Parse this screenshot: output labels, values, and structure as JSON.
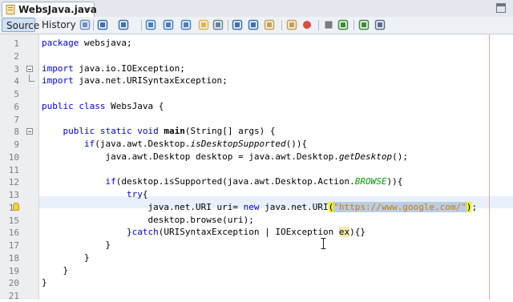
{
  "tab": {
    "filename": "WebsJava.java",
    "close_glyph": "×"
  },
  "toolbar": {
    "source_label": "Source",
    "history_label": "History",
    "icons": [
      "last-edit-icon",
      "back-icon",
      "forward-icon",
      "find-selection-icon",
      "find-previous-icon",
      "find-next-icon",
      "toggle-highlight-icon",
      "toggle-rectangular-icon",
      "shift-left-icon",
      "shift-right-icon",
      "comment-icon",
      "uncomment-icon",
      "start-macro-icon",
      "stop-macro-icon",
      "next-bookmark-icon",
      "previous-bookmark-icon",
      "toggle-bookmark-icon"
    ]
  },
  "editor": {
    "line_numbers": [
      "1",
      "2",
      "3",
      "4",
      "5",
      "6",
      "7",
      "8",
      "9",
      "10",
      "11",
      "12",
      "13",
      "14",
      "15",
      "16",
      "17",
      "18",
      "19",
      "20",
      "21"
    ],
    "lines": [
      {
        "segs": [
          {
            "t": "package",
            "c": "kw"
          },
          {
            "t": " websjava;"
          }
        ]
      },
      {
        "segs": []
      },
      {
        "segs": [
          {
            "t": "import",
            "c": "kw"
          },
          {
            "t": " java.io.IOException;"
          }
        ],
        "fold": "start"
      },
      {
        "segs": [
          {
            "t": "import",
            "c": "kw"
          },
          {
            "t": " java.net.URISyntaxException;"
          }
        ],
        "fold": "end"
      },
      {
        "segs": []
      },
      {
        "segs": [
          {
            "t": "public",
            "c": "kw"
          },
          {
            "t": " "
          },
          {
            "t": "class",
            "c": "kw"
          },
          {
            "t": " WebsJava {"
          }
        ]
      },
      {
        "segs": []
      },
      {
        "segs": [
          {
            "t": "    "
          },
          {
            "t": "public",
            "c": "kw"
          },
          {
            "t": " "
          },
          {
            "t": "static",
            "c": "kw"
          },
          {
            "t": " "
          },
          {
            "t": "void",
            "c": "kw"
          },
          {
            "t": " "
          },
          {
            "t": "main",
            "c": "bold"
          },
          {
            "t": "(String[] args) {"
          }
        ],
        "fold": "start"
      },
      {
        "segs": [
          {
            "t": "        "
          },
          {
            "t": "if",
            "c": "kw"
          },
          {
            "t": "(java.awt.Desktop."
          },
          {
            "t": "isDesktopSupported",
            "c": "mth"
          },
          {
            "t": "()){"
          }
        ]
      },
      {
        "segs": [
          {
            "t": "            java.awt.Desktop desktop = java.awt.Desktop."
          },
          {
            "t": "getDesktop",
            "c": "mth"
          },
          {
            "t": "();"
          }
        ]
      },
      {
        "segs": []
      },
      {
        "segs": [
          {
            "t": "            "
          },
          {
            "t": "if",
            "c": "kw"
          },
          {
            "t": "(desktop.isSupported(java.awt.Desktop.Action."
          },
          {
            "t": "BROWSE",
            "c": "fld"
          },
          {
            "t": ")){"
          }
        ]
      },
      {
        "segs": [
          {
            "t": "                "
          },
          {
            "t": "try",
            "c": "kw"
          },
          {
            "t": "{"
          }
        ]
      },
      {
        "segs": [
          {
            "t": "                    java.net.URI uri= "
          },
          {
            "t": "new",
            "c": "kw"
          },
          {
            "t": " java.net.URI"
          },
          {
            "t": "(",
            "c": "brace"
          },
          {
            "t": "\"https://www.google.com/\"",
            "c": "str sel"
          },
          {
            "t": ")",
            "c": "brace"
          },
          {
            "t": ";"
          }
        ],
        "bulb": true
      },
      {
        "segs": [
          {
            "t": "                    desktop.browse(uri);"
          }
        ]
      },
      {
        "segs": [
          {
            "t": "                }"
          },
          {
            "t": "catch",
            "c": "kw"
          },
          {
            "t": "(URISyntaxException | IOException "
          },
          {
            "t": "ex",
            "c": "mark"
          },
          {
            "t": "){}"
          }
        ]
      },
      {
        "segs": [
          {
            "t": "            }"
          }
        ]
      },
      {
        "segs": [
          {
            "t": "        }"
          }
        ]
      },
      {
        "segs": [
          {
            "t": "    }"
          }
        ]
      },
      {
        "segs": [
          {
            "t": "}"
          }
        ]
      },
      {
        "segs": []
      }
    ]
  },
  "colors": {
    "keyword": "#0000e6",
    "string": "#ce7b00",
    "selection": "#b9cde6",
    "margin_line": "#f2a0a0",
    "current_line": "#e8f0fb"
  }
}
